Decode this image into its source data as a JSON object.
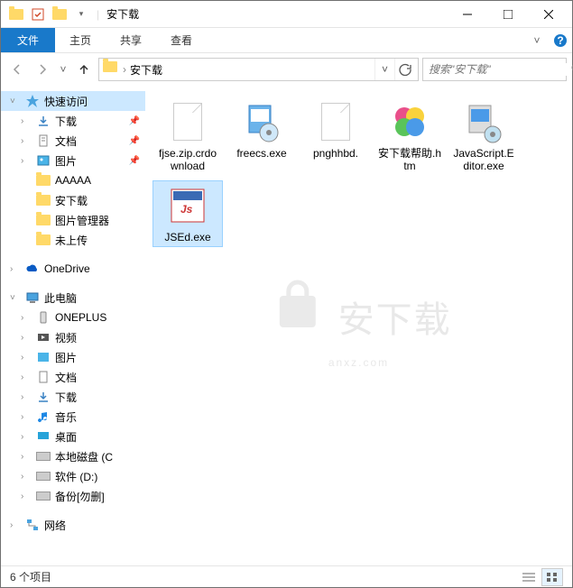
{
  "window": {
    "title": "安下载"
  },
  "ribbon": {
    "file": "文件",
    "tabs": [
      "主页",
      "共享",
      "查看"
    ]
  },
  "nav": {
    "crumb": "安下载",
    "search_placeholder": "搜索\"安下载\""
  },
  "tree": {
    "quick_access": "快速访问",
    "items_pinned": [
      {
        "label": "下载",
        "icon": "download"
      },
      {
        "label": "文档",
        "icon": "document"
      },
      {
        "label": "图片",
        "icon": "picture"
      }
    ],
    "items_recent": [
      {
        "label": "AAAAA"
      },
      {
        "label": "安下载"
      },
      {
        "label": "图片管理器"
      },
      {
        "label": "未上传"
      }
    ],
    "onedrive": "OneDrive",
    "this_pc": "此电脑",
    "pc_items": [
      {
        "label": "ONEPLUS",
        "icon": "phone"
      },
      {
        "label": "视频",
        "icon": "video"
      },
      {
        "label": "图片",
        "icon": "picture"
      },
      {
        "label": "文档",
        "icon": "document"
      },
      {
        "label": "下载",
        "icon": "download"
      },
      {
        "label": "音乐",
        "icon": "music"
      },
      {
        "label": "桌面",
        "icon": "desktop"
      },
      {
        "label": "本地磁盘 (C",
        "icon": "drive"
      },
      {
        "label": "软件 (D:)",
        "icon": "drive"
      },
      {
        "label": "备份[勿删]",
        "icon": "drive"
      }
    ],
    "network": "网络"
  },
  "files": [
    {
      "name": "fjse.zip.crdownload",
      "type": "file"
    },
    {
      "name": "freecs.exe",
      "type": "exe-disc"
    },
    {
      "name": "pnghhbd.",
      "type": "file"
    },
    {
      "name": "安下载帮助.htm",
      "type": "htm"
    },
    {
      "name": "JavaScript.Editor.exe",
      "type": "exe-installer"
    },
    {
      "name": "JSEd.exe",
      "type": "exe-js",
      "selected": true
    }
  ],
  "status": {
    "count": "6 个项目"
  },
  "watermark": {
    "line1": "安下载",
    "line2": "anxz.com"
  }
}
